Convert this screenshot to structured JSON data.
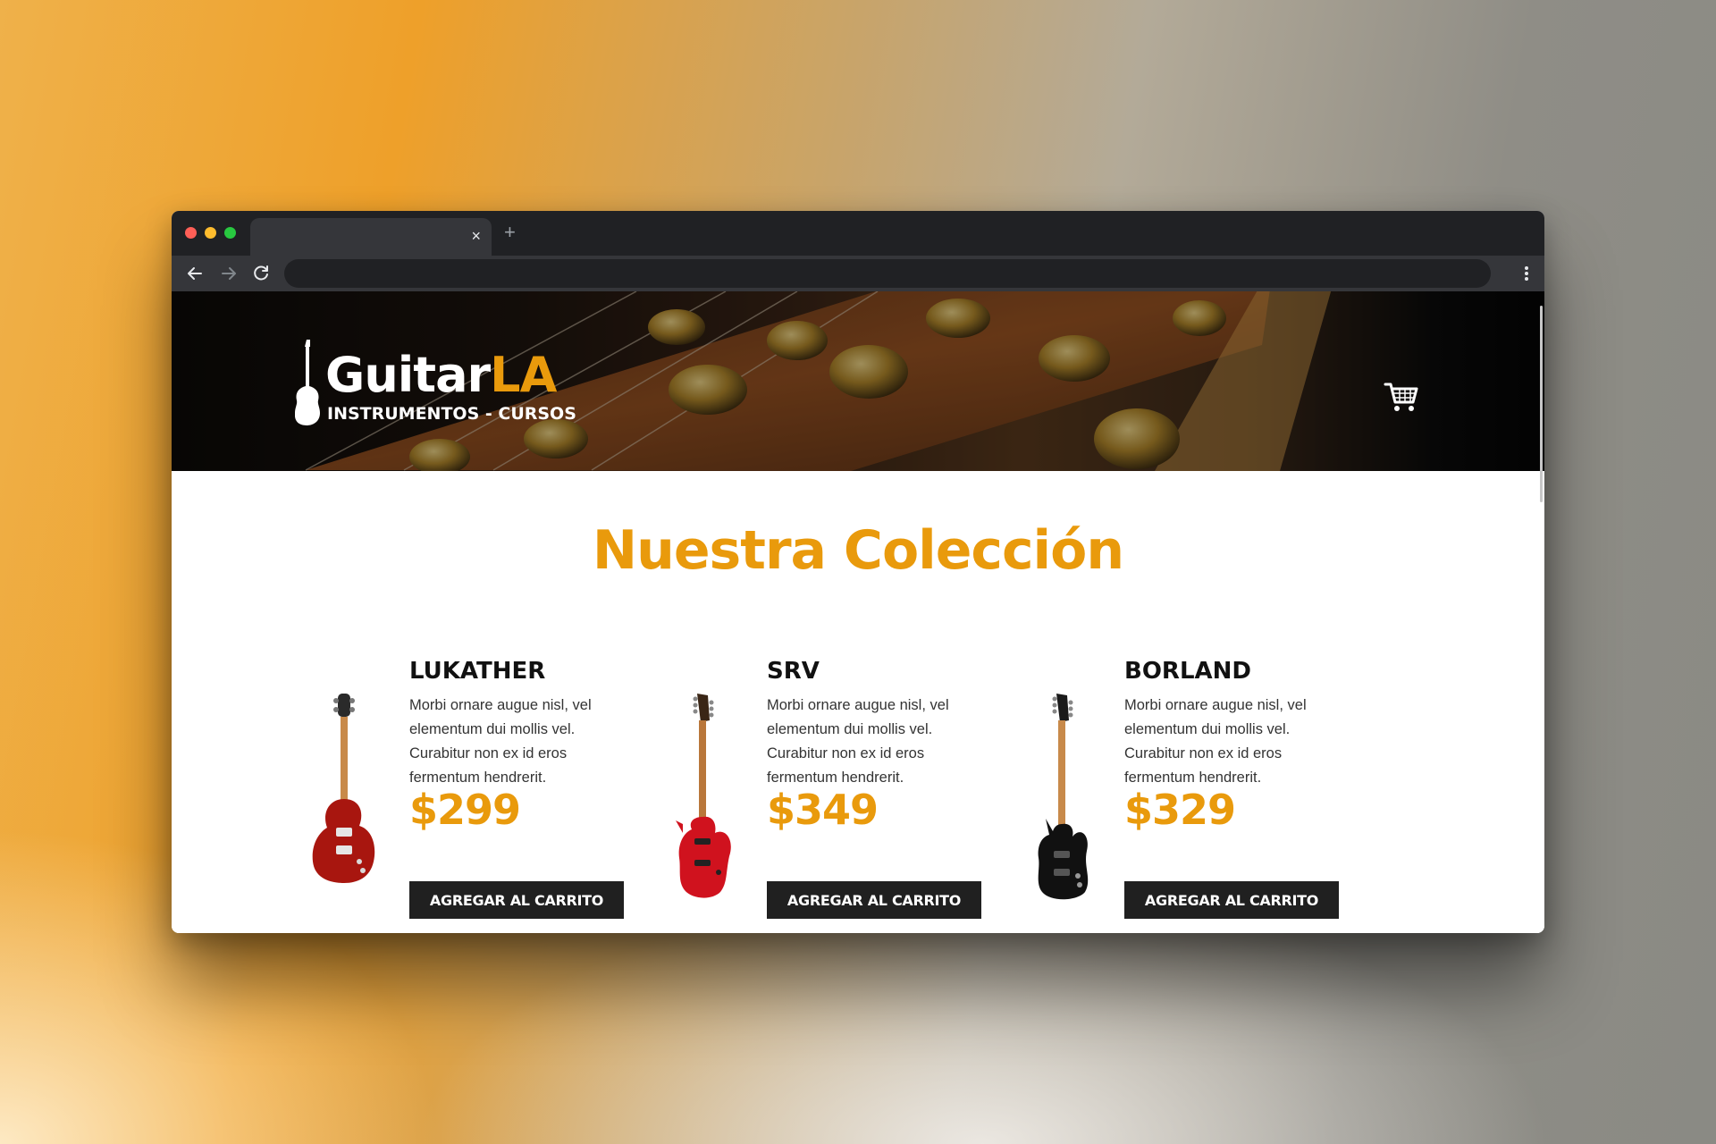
{
  "browser": {
    "tab_close_glyph": "×",
    "new_tab_glyph": "+",
    "address": ""
  },
  "site": {
    "logo_main": "Guitar",
    "logo_accent": "LA",
    "logo_subtitle": "INSTRUMENTOS - CURSOS",
    "icons": {
      "logo": "guitar-icon",
      "cart": "shopping-cart-icon"
    }
  },
  "collection": {
    "heading": "Nuestra Colección",
    "products": [
      {
        "name": "LUKATHER",
        "description": "Morbi ornare augue nisl, vel elementum dui mollis vel. Curabitur non ex id eros fermentum hendrerit.",
        "price": "$299",
        "button": "AGREGAR AL CARRITO",
        "color": "#a8160f"
      },
      {
        "name": "SRV",
        "description": "Morbi ornare augue nisl, vel elementum dui mollis vel. Curabitur non ex id eros fermentum hendrerit.",
        "price": "$349",
        "button": "AGREGAR AL CARRITO",
        "color": "#d0121e"
      },
      {
        "name": "BORLAND",
        "description": "Morbi ornare augue nisl, vel elementum dui mollis vel. Curabitur non ex id eros fermentum hendrerit.",
        "price": "$329",
        "button": "AGREGAR AL CARRITO",
        "color": "#111111"
      }
    ]
  },
  "colors": {
    "accent": "#e99a0c",
    "button_bg": "#202020",
    "browser_dark": "#202124"
  }
}
